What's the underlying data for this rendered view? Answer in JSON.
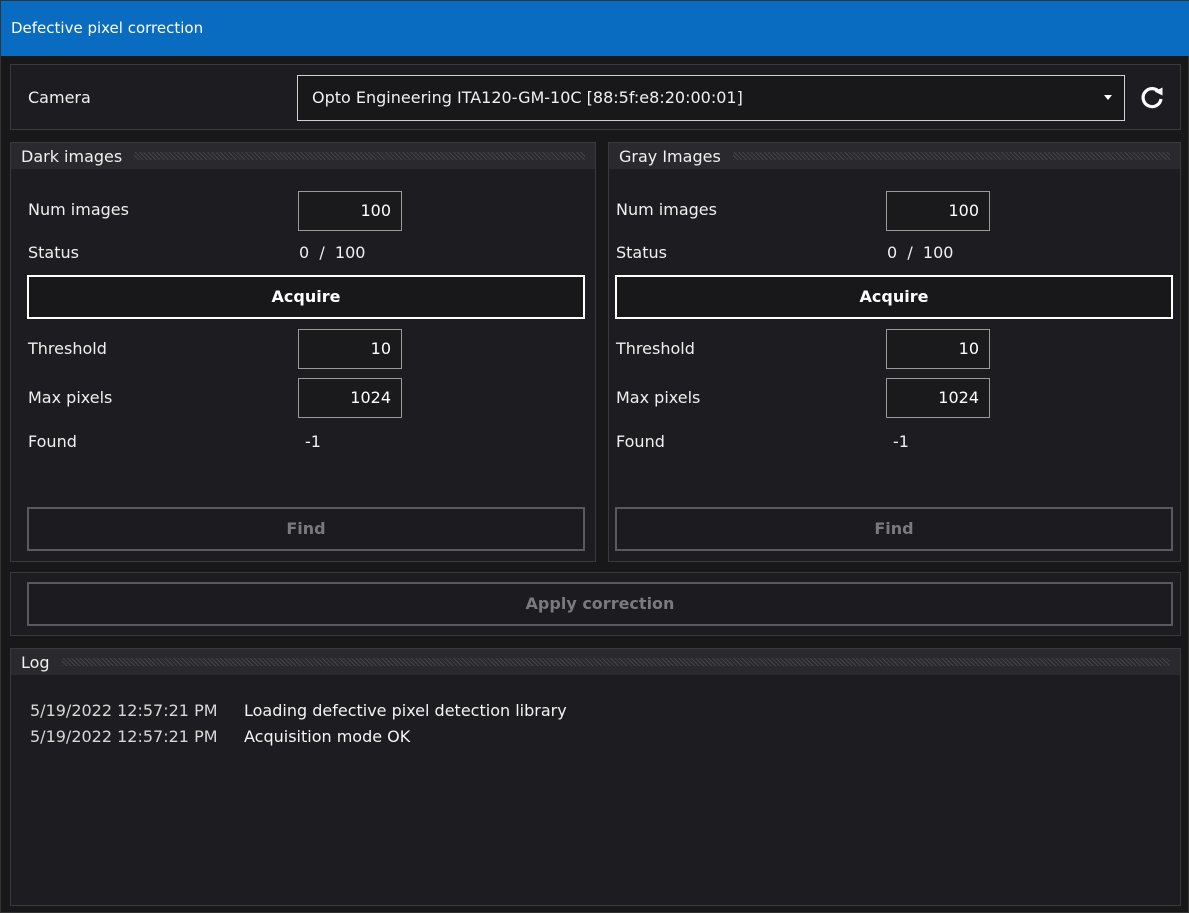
{
  "window": {
    "title": "Defective pixel correction"
  },
  "camera": {
    "label": "Camera",
    "selected": "Opto Engineering ITA120-GM-10C [88:5f:e8:20:00:01]",
    "refresh_icon": "refresh-icon"
  },
  "dark": {
    "title": "Dark images",
    "num_images_label": "Num images",
    "num_images": "100",
    "status_label": "Status",
    "status": "0  /  100",
    "acquire_label": "Acquire",
    "threshold_label": "Threshold",
    "threshold": "10",
    "max_pixels_label": "Max pixels",
    "max_pixels": "1024",
    "found_label": "Found",
    "found": "-1",
    "find_label": "Find"
  },
  "gray": {
    "title": "Gray Images",
    "num_images_label": "Num images",
    "num_images": "100",
    "status_label": "Status",
    "status": "0  /  100",
    "acquire_label": "Acquire",
    "threshold_label": "Threshold",
    "threshold": "10",
    "max_pixels_label": "Max pixels",
    "max_pixels": "1024",
    "found_label": "Found",
    "found": "-1",
    "find_label": "Find"
  },
  "apply": {
    "label": "Apply correction"
  },
  "log": {
    "title": "Log",
    "entries": [
      {
        "time": "5/19/2022 12:57:21 PM",
        "message": "Loading defective pixel detection library"
      },
      {
        "time": "5/19/2022 12:57:21 PM",
        "message": "Acquisition mode OK"
      }
    ]
  },
  "colors": {
    "titlebar": "#0a6cc0",
    "background": "#18181b",
    "panel": "#1d1d21"
  }
}
